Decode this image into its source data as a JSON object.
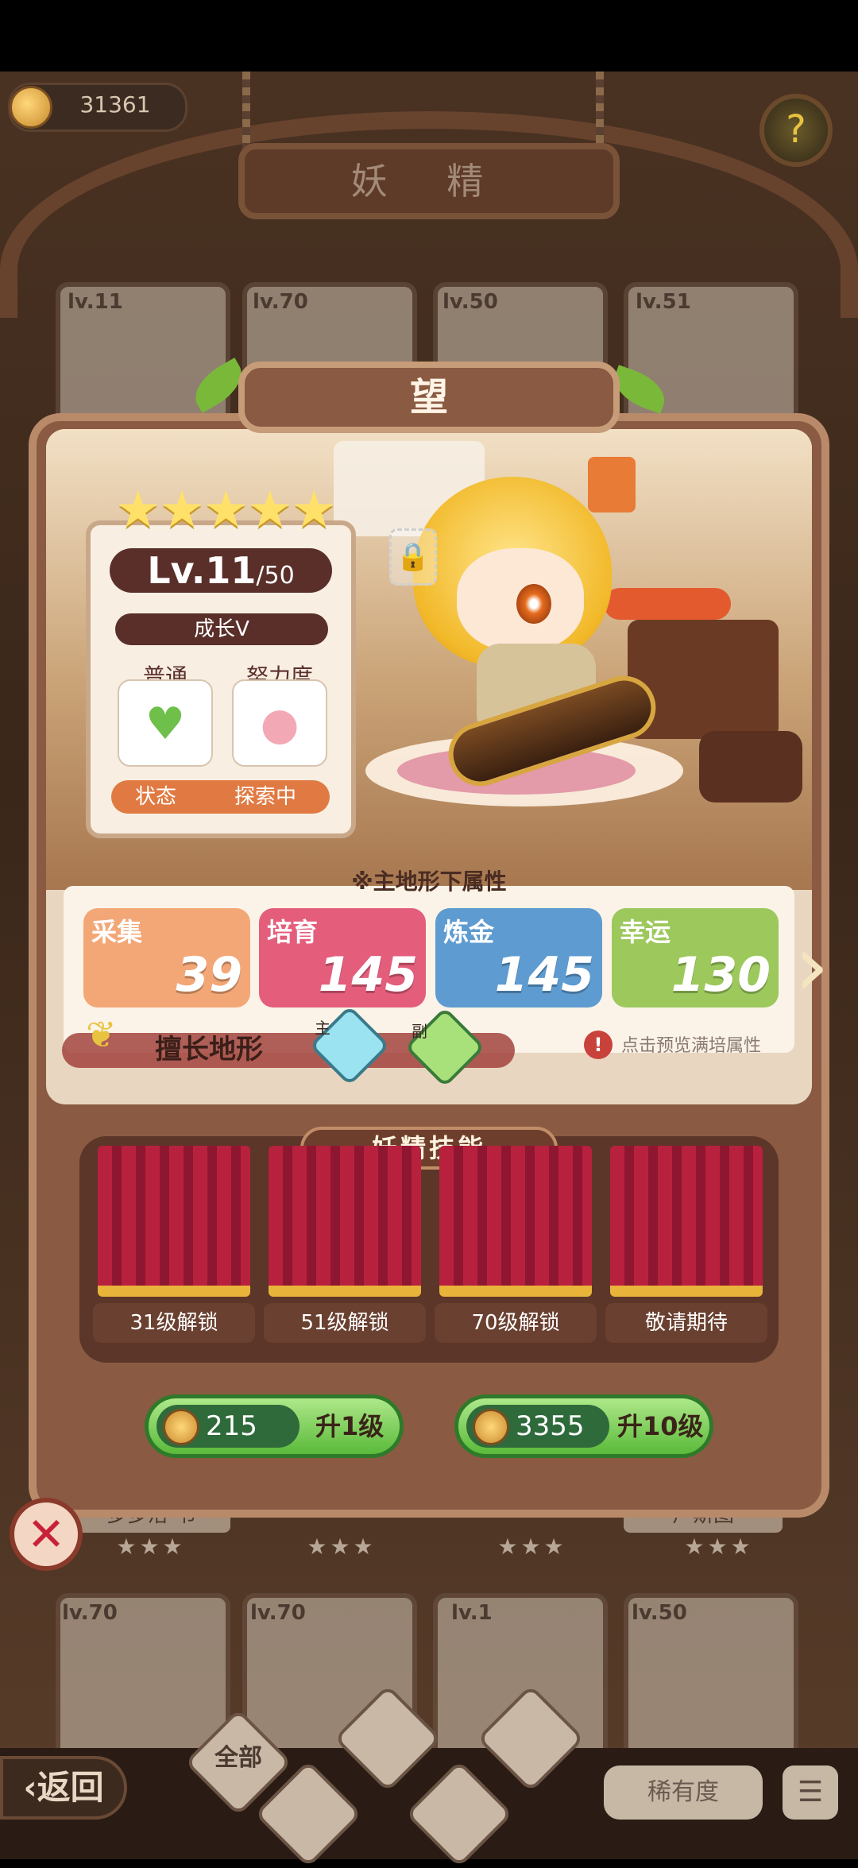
{
  "header": {
    "coin_value": "31361",
    "title": "妖 精",
    "help_icon": "?"
  },
  "background_cards": {
    "top_levels": [
      "lv.11",
      "lv.70",
      "lv.50",
      "lv.51"
    ],
    "middle_names": [
      "多多洛·书",
      "",
      "",
      "卢斯图"
    ],
    "bottom_levels": [
      "lv.70",
      "lv.70",
      "lv.1",
      "lv.50"
    ]
  },
  "fairy": {
    "name": "望",
    "stars": "★★★★★",
    "level": "Lv.11",
    "level_max": "/50",
    "growth": "成长V",
    "mood_label": "普通",
    "effort_label": "努力度",
    "status_label": "状态",
    "status_value": "探索中",
    "mood_icon": "heart-icon",
    "effort_icon": "pig-face-icon"
  },
  "attributes": {
    "section_title": "※主地形下属性",
    "items": [
      {
        "label": "采集",
        "value": "39",
        "color": "#f3a777"
      },
      {
        "label": "培育",
        "value": "145",
        "color": "#e45e7c"
      },
      {
        "label": "炼金",
        "value": "145",
        "color": "#5e9bd0"
      },
      {
        "label": "幸运",
        "value": "130",
        "color": "#9cc85c"
      }
    ],
    "terrain_label": "擅长地形",
    "main_tag": "主",
    "sub_tag": "副",
    "preview_hint": "点击预览满培属性"
  },
  "skills": {
    "title": "妖精技能",
    "slots": [
      "31级解锁",
      "51级解锁",
      "70级解锁",
      "敬请期待"
    ]
  },
  "upgrade": {
    "one": {
      "cost": "215",
      "label": "升1级"
    },
    "ten": {
      "cost": "3355",
      "label": "升10级"
    }
  },
  "nav": {
    "back_label": "返回",
    "all_label": "全部",
    "rarity_label": "稀有度",
    "sort_icon": "☰"
  },
  "colors": {
    "accent_green": "#5aba3a",
    "panel_brown": "#8a5a42",
    "close_red": "#c8213a"
  }
}
